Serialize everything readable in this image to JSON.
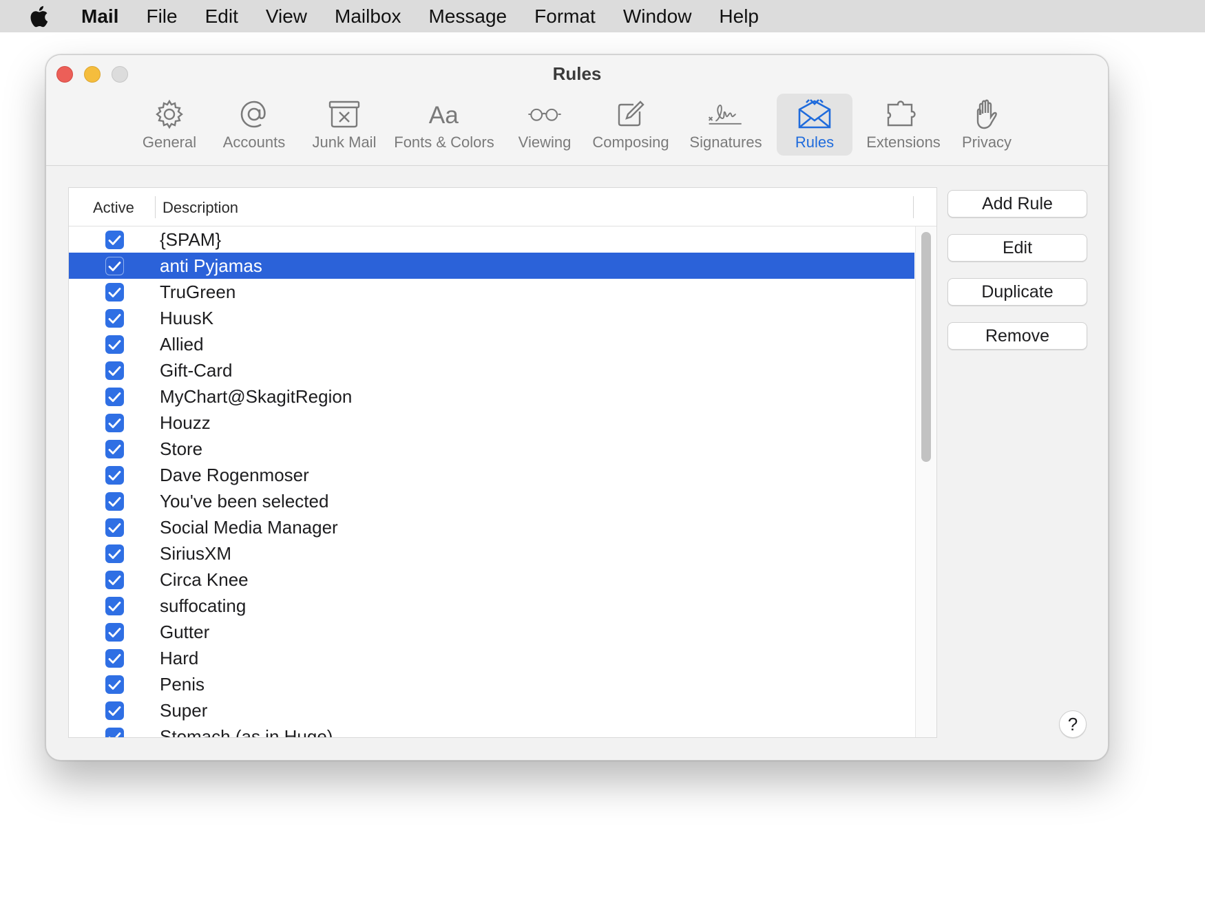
{
  "menubar": {
    "app": "Mail",
    "items": [
      "File",
      "Edit",
      "View",
      "Mailbox",
      "Message",
      "Format",
      "Window",
      "Help"
    ]
  },
  "window": {
    "title": "Rules",
    "tabs": [
      {
        "label": "General",
        "icon": "gear-icon"
      },
      {
        "label": "Accounts",
        "icon": "at-icon"
      },
      {
        "label": "Junk Mail",
        "icon": "junk-mail-icon"
      },
      {
        "label": "Fonts & Colors",
        "icon": "fonts-icon"
      },
      {
        "label": "Viewing",
        "icon": "glasses-icon"
      },
      {
        "label": "Composing",
        "icon": "compose-icon"
      },
      {
        "label": "Signatures",
        "icon": "signature-icon"
      },
      {
        "label": "Rules",
        "icon": "rules-envelope-icon",
        "active": true
      },
      {
        "label": "Extensions",
        "icon": "puzzle-icon"
      },
      {
        "label": "Privacy",
        "icon": "hand-icon"
      }
    ]
  },
  "table": {
    "columns": {
      "active": "Active",
      "description": "Description"
    },
    "rows": [
      {
        "active": true,
        "description": "{SPAM}"
      },
      {
        "active": true,
        "description": "anti Pyjamas",
        "selected": true
      },
      {
        "active": true,
        "description": "TruGreen"
      },
      {
        "active": true,
        "description": "HuusK"
      },
      {
        "active": true,
        "description": "Allied"
      },
      {
        "active": true,
        "description": "Gift-Card"
      },
      {
        "active": true,
        "description": " MyChart@SkagitRegion"
      },
      {
        "active": true,
        "description": "Houzz"
      },
      {
        "active": true,
        "description": "Store"
      },
      {
        "active": true,
        "description": "Dave Rogenmoser"
      },
      {
        "active": true,
        "description": "You've been selected"
      },
      {
        "active": true,
        "description": "Social Media Manager"
      },
      {
        "active": true,
        "description": "SiriusXM"
      },
      {
        "active": true,
        "description": "Circa Knee"
      },
      {
        "active": true,
        "description": "suffocating"
      },
      {
        "active": true,
        "description": "Gutter"
      },
      {
        "active": true,
        "description": "Hard"
      },
      {
        "active": true,
        "description": "Penis"
      },
      {
        "active": true,
        "description": "Super"
      },
      {
        "active": true,
        "description": "Stomach (as in Huge)"
      }
    ]
  },
  "buttons": {
    "add_rule": "Add Rule",
    "edit": "Edit",
    "duplicate": "Duplicate",
    "remove": "Remove",
    "help": "?"
  },
  "colors": {
    "accent": "#2f6fe4",
    "selection": "#2b62d9",
    "active_tab_label": "#1f6bdc"
  }
}
